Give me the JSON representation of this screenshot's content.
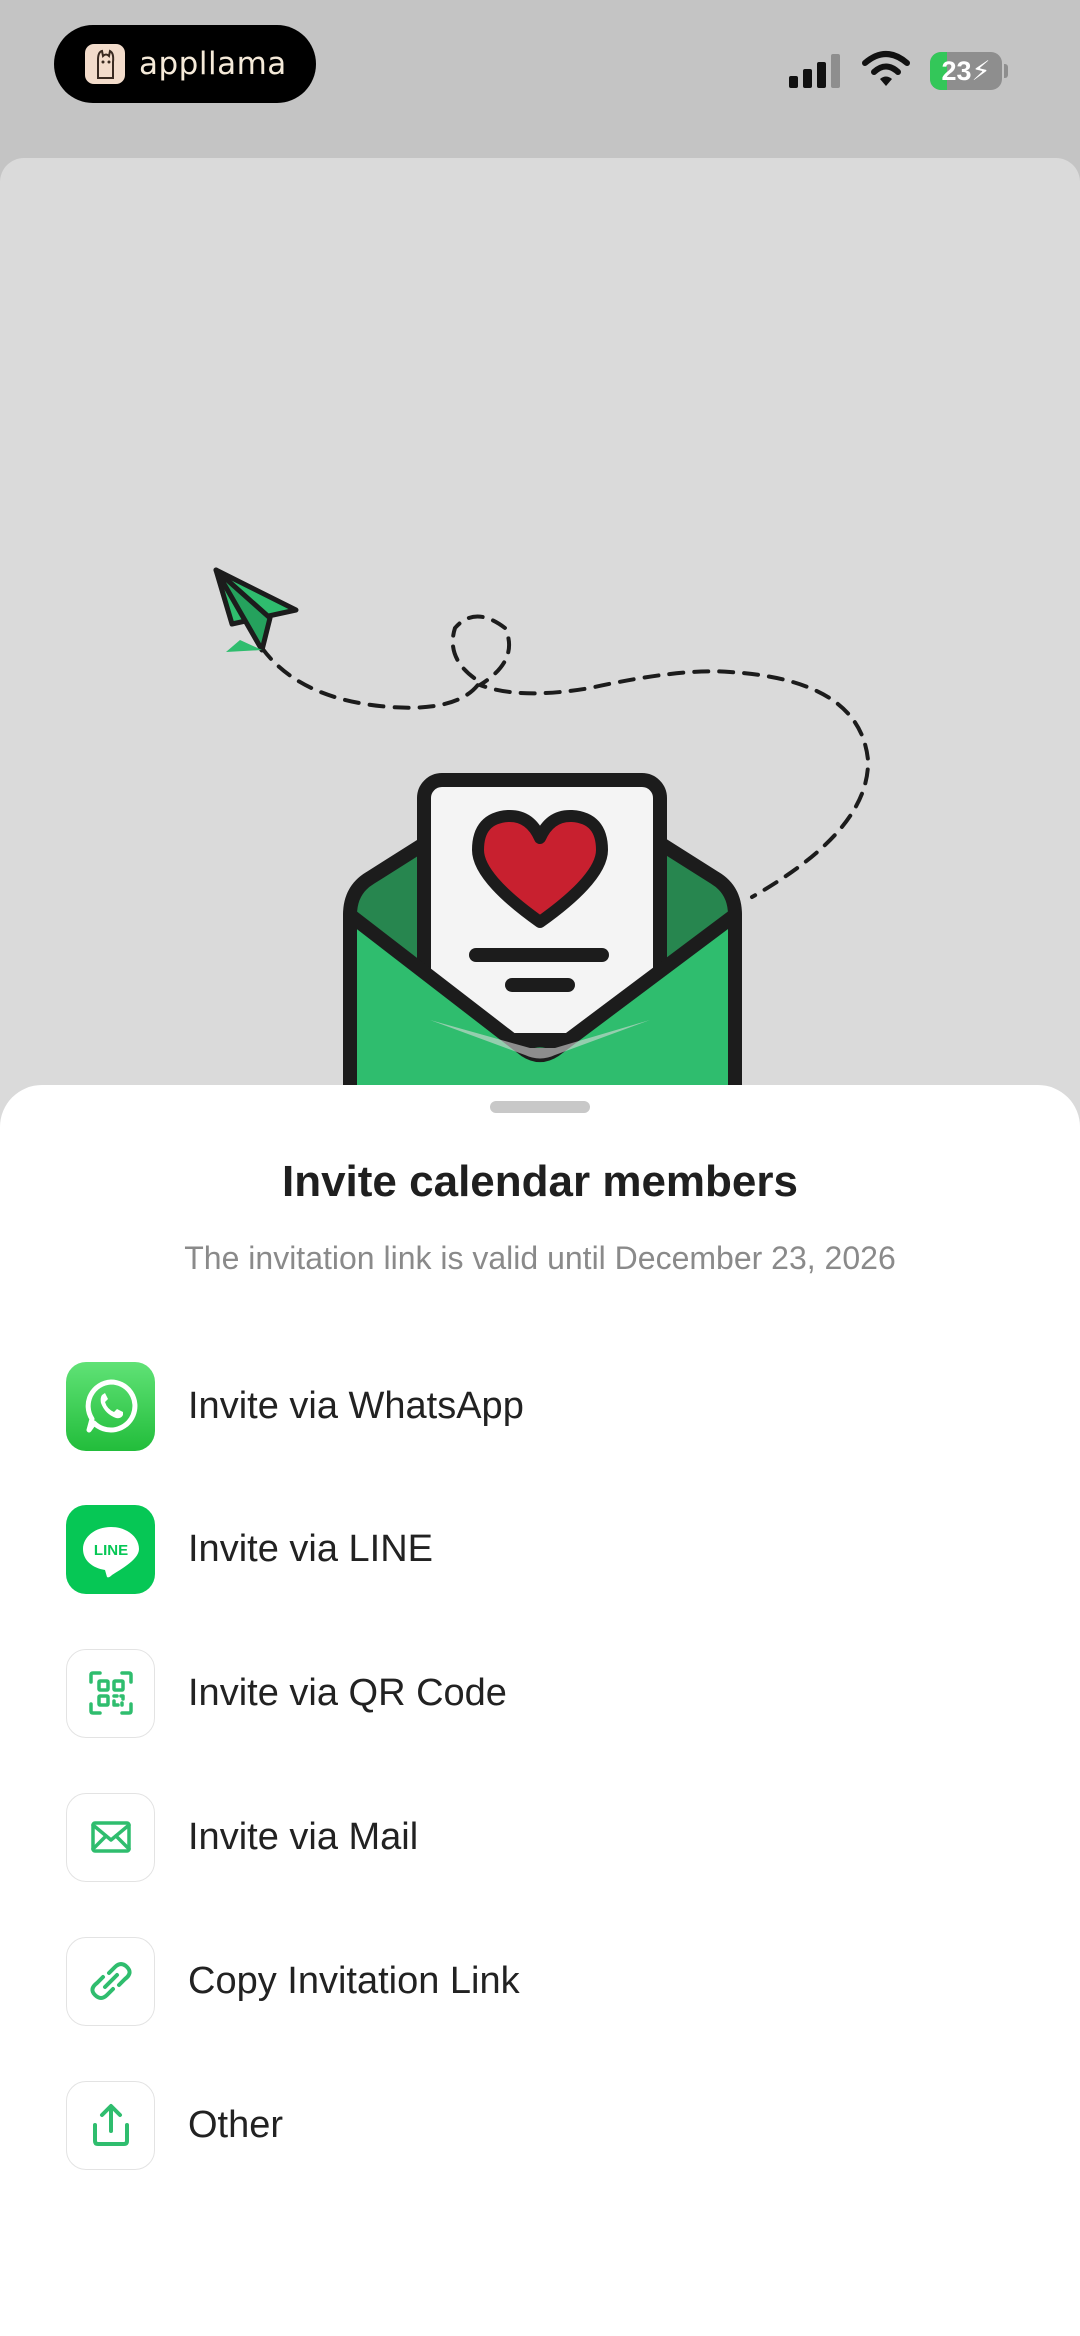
{
  "status_bar": {
    "app_name": "appllama",
    "battery_level": "23",
    "battery_fraction": 0.23
  },
  "sheet": {
    "title": "Invite calendar members",
    "subtitle": "The invitation link is valid until December 23, 2026",
    "options": [
      {
        "label": "Invite via WhatsApp",
        "icon": "whatsapp-icon"
      },
      {
        "label": "Invite via LINE",
        "icon": "line-icon",
        "icon_text": "LINE"
      },
      {
        "label": "Invite via QR Code",
        "icon": "qr-code-icon"
      },
      {
        "label": "Invite via Mail",
        "icon": "mail-icon"
      },
      {
        "label": "Copy Invitation Link",
        "icon": "link-icon"
      },
      {
        "label": "Other",
        "icon": "share-icon"
      }
    ]
  },
  "colors": {
    "accent_green": "#2fbd6e",
    "whatsapp_green": "#3ecf4c",
    "line_green": "#06c755",
    "heart_red": "#c8202f"
  }
}
